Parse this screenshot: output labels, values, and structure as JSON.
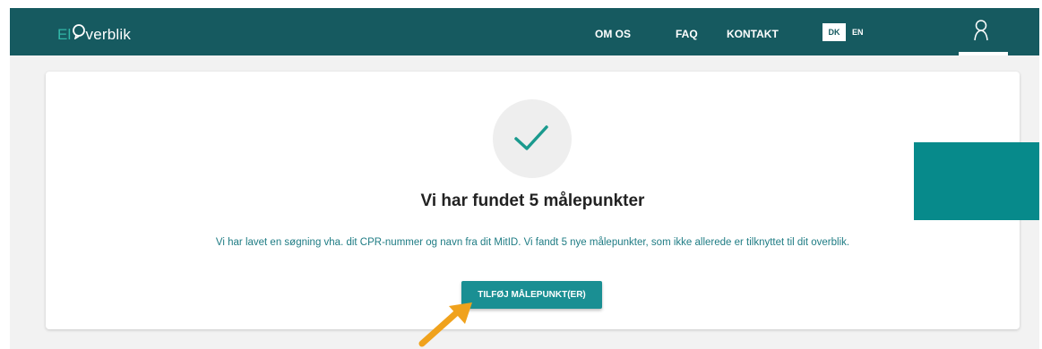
{
  "header": {
    "logo_el": "El",
    "logo_rest": "verblik",
    "nav": [
      {
        "label": "OM OS"
      },
      {
        "label": "FAQ"
      },
      {
        "label": "KONTAKT"
      }
    ],
    "lang_active": "DK",
    "lang_other": "EN",
    "brand_color": "#165a60"
  },
  "main": {
    "title": "Vi har fundet 5 målepunkter",
    "description": "Vi har lavet en søgning vha. dit CPR-nummer og navn fra dit MitID. Vi fandt 5 nye målepunkter, som ikke allerede er tilknyttet til dit overblik.",
    "button_label": "TILFØJ MÅLEPUNKT(ER)",
    "icons": {
      "status": "checkmark-icon",
      "user": "user-icon",
      "annotation": "arrow-icon"
    },
    "accent_color": "#1a8f93"
  }
}
